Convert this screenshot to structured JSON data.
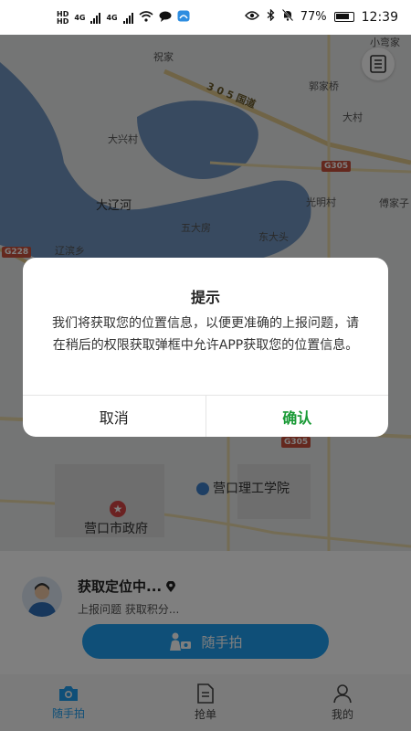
{
  "status_bar": {
    "network_1": "HD",
    "network_1_sub": "1",
    "network_2": "HD",
    "network_2_sub": "2",
    "signal_1": "4G",
    "signal_2": "4G",
    "wifi_text": "6",
    "battery_percent": "77%",
    "time": "12:39"
  },
  "map": {
    "labels": {
      "zhujia": "祝家",
      "xiaoqingjia": "小弯家",
      "guojiaqiao": "郭家桥",
      "road_305": "3 0 5 国道",
      "daxingcun": "大兴村",
      "dacun": "大村",
      "g305": "G305",
      "daliaohe": "大辽河",
      "guangmingcun": "光明村",
      "fujiazi": "傅家子",
      "wudafang": "五大房",
      "dongdatou": "东大头",
      "liaobinxiang": "辽滨乡",
      "g228": "G228",
      "yingkou_ligong": "营口理工学院",
      "yingkou_zhengfu": "营口市政府",
      "g305_2": "G305"
    }
  },
  "panel": {
    "location_title": "获取定位中...",
    "location_sub": "上报问题 获取积分...",
    "main_button_label": "随手拍"
  },
  "nav": {
    "items": [
      {
        "label": "随手拍"
      },
      {
        "label": "抢单"
      },
      {
        "label": "我的"
      }
    ]
  },
  "dialog": {
    "title": "提示",
    "message": "我们将获取您的位置信息，以便更准确的上报问题，请在稍后的权限获取弹框中允许APP获取您的位置信息。",
    "cancel_label": "取消",
    "confirm_label": "确认"
  },
  "colors": {
    "accent": "#1f9ff0",
    "confirm": "#1a9a36",
    "river": "#5b86b9"
  }
}
